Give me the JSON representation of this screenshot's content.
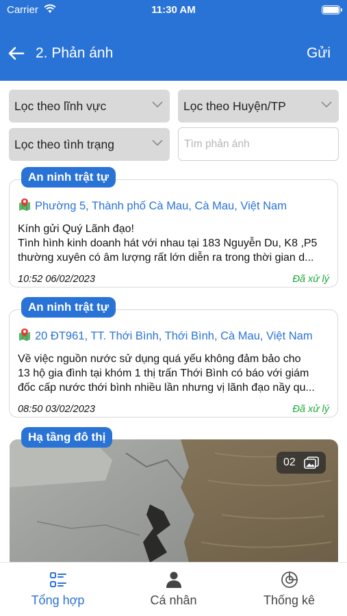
{
  "status_bar": {
    "carrier": "Carrier",
    "time": "11:30 AM"
  },
  "nav": {
    "title": "2. Phản ánh",
    "action": "Gửi",
    "back_icon": "arrow-left-icon"
  },
  "filters": {
    "field": "Lọc theo lĩnh vực",
    "district": "Lọc theo Huyện/TP",
    "status": "Lọc theo tình trạng",
    "search_placeholder": "Tìm phản ánh",
    "search_value": ""
  },
  "reports": [
    {
      "category": "An ninh trật tự",
      "location": "Phường 5, Thành phố Cà Mau, Cà Mau, Việt Nam",
      "desc_line1": "Kính gửi Quý Lãnh đạo!",
      "desc_line2": "Tình hình kinh doanh hát với nhau tại 183 Nguyễn Du, K8 ,P5",
      "desc_line3": "thường xuyên có âm lượng rất lớn diễn ra trong thời gian d...",
      "time": "10:52 06/02/2023",
      "status": "Đã xử lý"
    },
    {
      "category": "An ninh trật tự",
      "location": "20 ĐT961, TT. Thới Bình, Thới Bình, Cà Mau, Việt Nam",
      "desc_line1": "Về việc nguồn nước sử dụng quá yếu không đảm bảo cho",
      "desc_line2": "13 hộ gia đình tại khóm 1 thị trấn Thới Bình có báo với giám",
      "desc_line3": "đốc cấp nước thới bình nhiều lần nhưng vị lãnh đạo nầy qu...",
      "time": "08:50 03/02/2023",
      "status": "Đã xử lý"
    },
    {
      "category": "Hạ tầng đô thị",
      "photo_count": "02"
    }
  ],
  "tabs": [
    {
      "label": "Tổng hợp",
      "icon": "list-icon",
      "active": true
    },
    {
      "label": "Cá nhân",
      "icon": "person-icon",
      "active": false
    },
    {
      "label": "Thống kê",
      "icon": "chart-icon",
      "active": false
    }
  ],
  "colors": {
    "primary": "#2a73d6",
    "status_done": "#1faa3a",
    "select_bg": "#d9d9d9"
  }
}
